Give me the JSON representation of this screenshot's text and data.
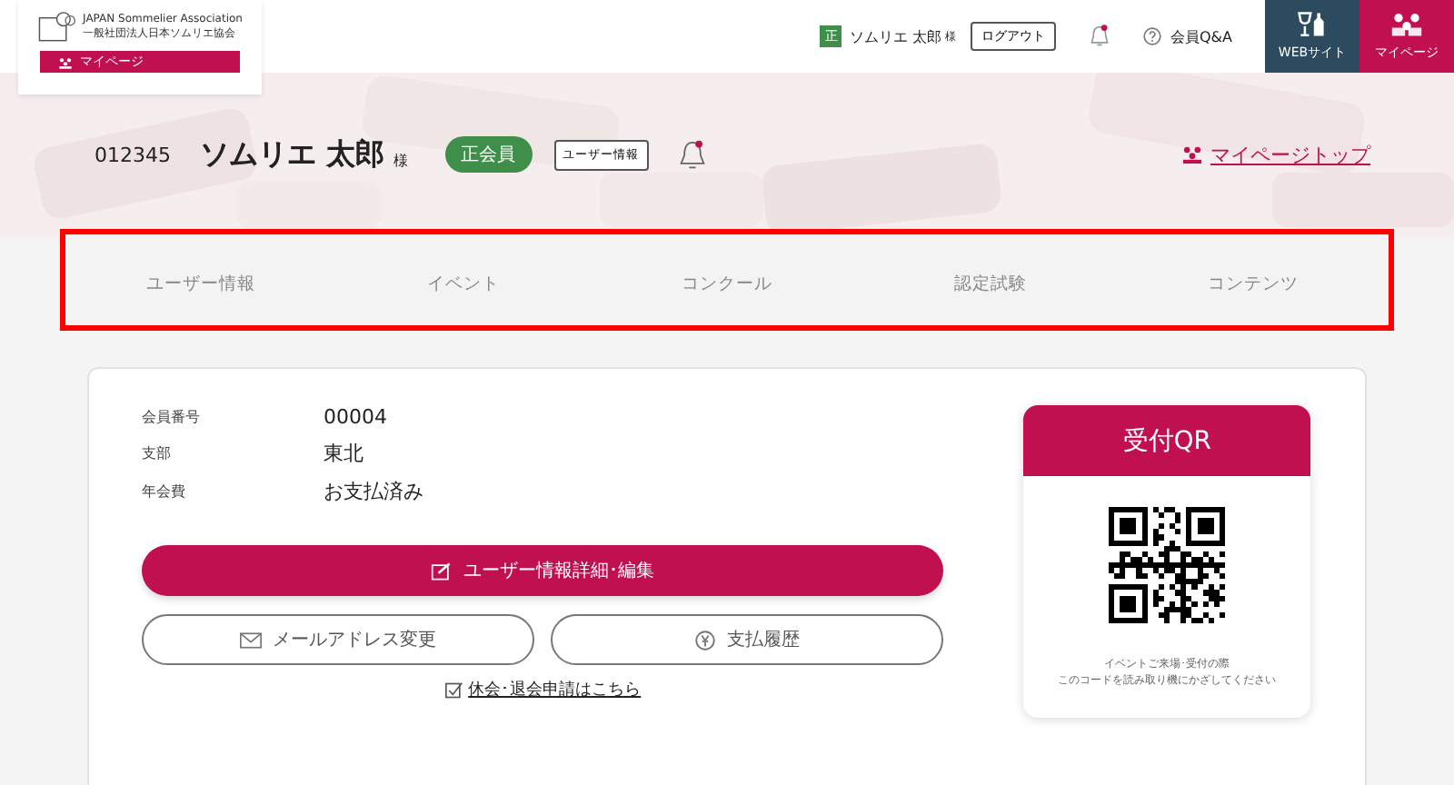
{
  "header": {
    "logo": {
      "line1": "JAPAN Sommelier Association",
      "line2": "一般社団法人日本ソムリエ協会",
      "tab": "マイページ"
    },
    "user": {
      "badge": "正",
      "name": "ソムリエ 太郎",
      "honorific": "様"
    },
    "logout": "ログアウト",
    "notifications": {
      "unread": true
    },
    "help": "会員Q&A",
    "nav_buttons": [
      {
        "label": "WEBサイト",
        "kind": "web",
        "selected": false
      },
      {
        "label": "マイページ",
        "kind": "mypage",
        "selected": true
      }
    ]
  },
  "profile": {
    "member_id": "012345",
    "name": "ソムリエ 太郎",
    "honorific": "様",
    "status": "正会員",
    "user_info_button": "ユーザー情報",
    "notifications": {
      "unread": true
    },
    "top_link": "マイページトップ"
  },
  "tabs": {
    "highlighted": true,
    "items": [
      {
        "label": "ユーザー情報",
        "selected": false
      },
      {
        "label": "イベント",
        "selected": false
      },
      {
        "label": "コンクール",
        "selected": false
      },
      {
        "label": "認定試験",
        "selected": false
      },
      {
        "label": "コンテンツ",
        "selected": false
      }
    ]
  },
  "details": [
    {
      "label": "会員番号",
      "value": "00004"
    },
    {
      "label": "支部",
      "value": "東北"
    },
    {
      "label": "年会費",
      "value": "お支払済み"
    }
  ],
  "primary_button": "ユーザー情報詳細･編集",
  "secondary_buttons": [
    {
      "label": "メールアドレス変更",
      "kind": "mail"
    },
    {
      "label": "支払履歴",
      "kind": "yen"
    }
  ],
  "withdraw_link": "休会･退会申請はこちら",
  "qr": {
    "title": "受付QR",
    "note_lines": [
      "イベントご来場･受付の際",
      "このコードを読み取り機にかざしてください"
    ]
  }
}
